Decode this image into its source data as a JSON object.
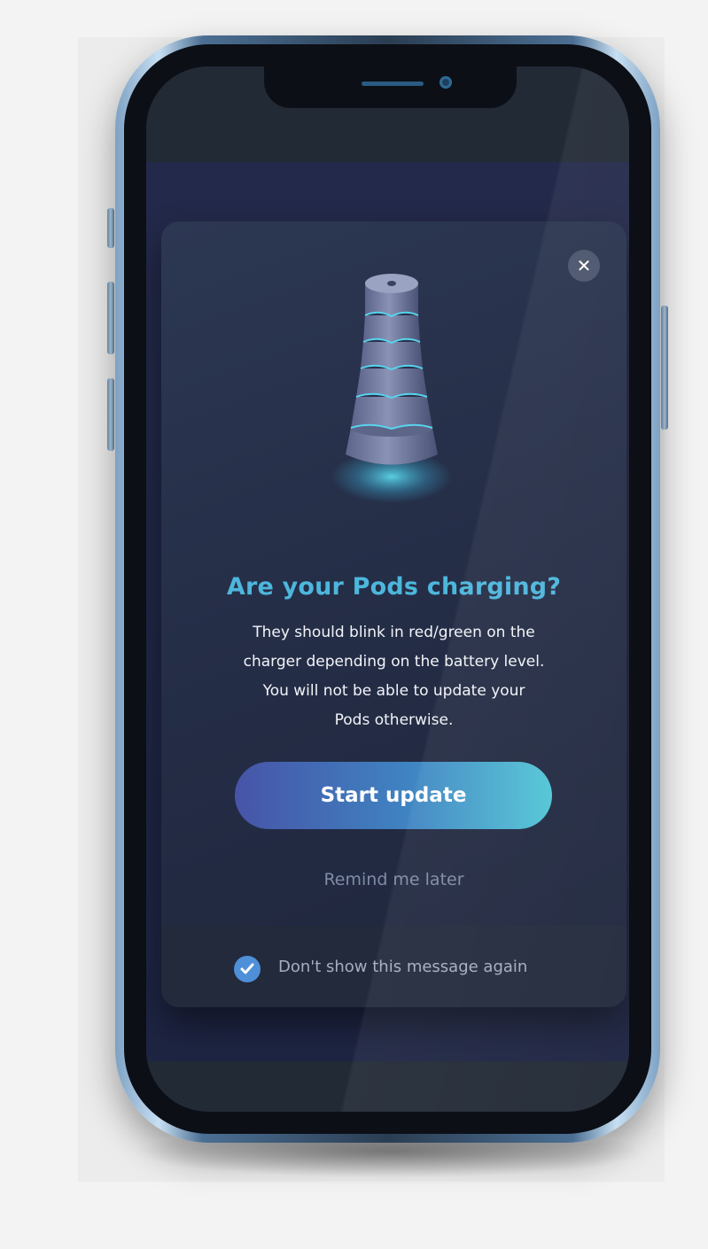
{
  "modal": {
    "close_icon": "close-icon",
    "illustration": "charging-pods-stack",
    "title": "Are your Pods charging?",
    "body_lines": [
      "They should blink in red/green on the",
      "charger depending on the battery level.",
      "You will not be able to update your",
      "Pods otherwise."
    ],
    "primary_button": "Start update",
    "secondary_link": "Remind me later",
    "checkbox": {
      "label": "Don't show this message again",
      "checked": true
    }
  },
  "colors": {
    "title": "#4db6dc",
    "button_gradient_start": "#4754a8",
    "button_gradient_end": "#52c6d6",
    "checkbox": "#4f8fd8",
    "modal_background": "#2c3752"
  }
}
